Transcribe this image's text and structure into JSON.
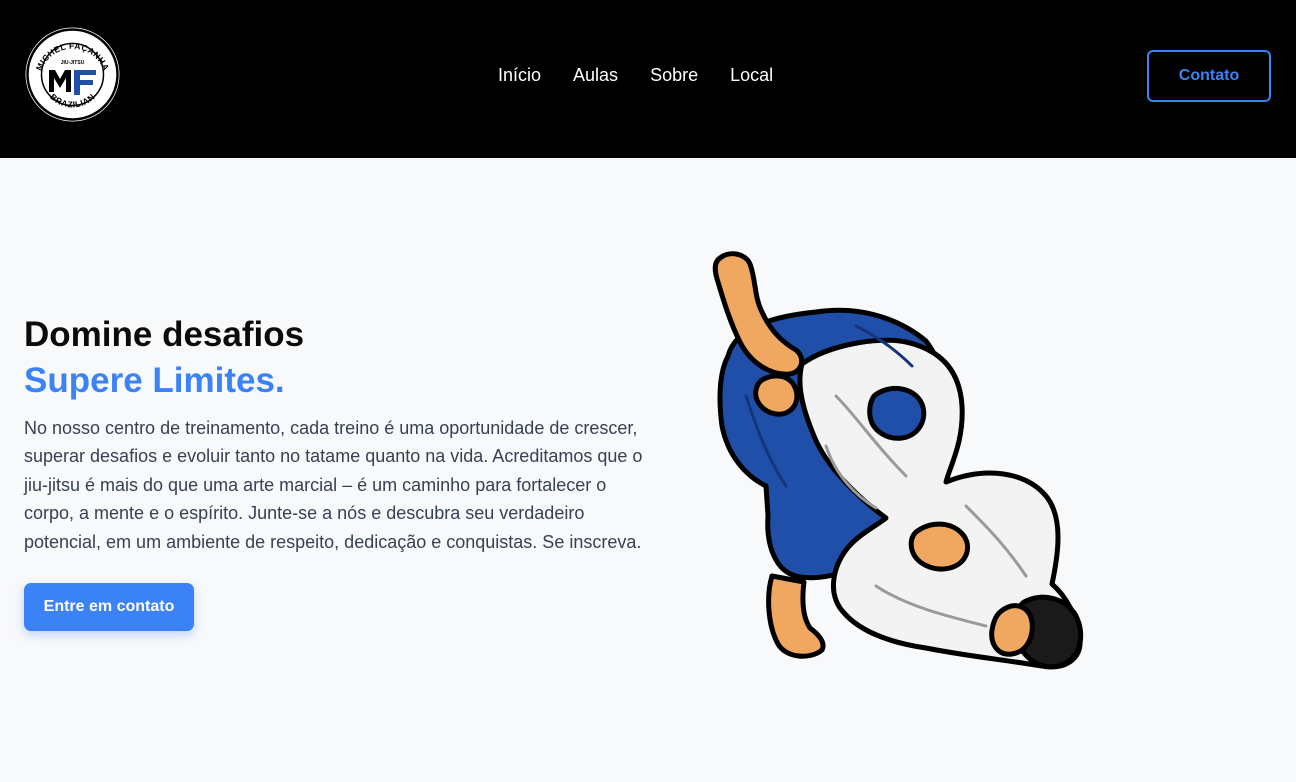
{
  "header": {
    "logo": {
      "top_text": "MICHEL FAÇANHA",
      "middle_text": "JIU-JITSU",
      "bottom_text": "BRAZILIAN",
      "monogram": "MF"
    },
    "nav": [
      {
        "label": "Início"
      },
      {
        "label": "Aulas"
      },
      {
        "label": "Sobre"
      },
      {
        "label": "Local"
      }
    ],
    "contact_label": "Contato"
  },
  "hero": {
    "title": "Domine desafios",
    "accent": "Supere Limites.",
    "description": "No nosso centro de treinamento, cada treino é uma oportunidade de crescer, superar desafios e evoluir tanto no tatame quanto na vida. Acreditamos que o jiu-jitsu é mais do que uma arte marcial – é um caminho para fortalecer o corpo, a mente e o espírito. Junte-se a nós e descubra seu verdadeiro potencial, em um ambiente de respeito, dedicação e conquistas. Se inscreva.",
    "cta_label": "Entre em contato"
  },
  "colors": {
    "accent": "#3b82f6",
    "header_bg": "#000000",
    "page_bg": "#f8f9fb",
    "gi_blue": "#1f4fa8",
    "skin": "#f0a860"
  },
  "illustration": {
    "subject": "jiu-jitsu-fighters-illustration"
  }
}
